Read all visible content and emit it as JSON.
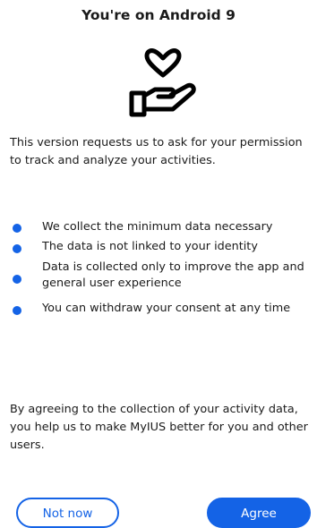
{
  "header": {
    "title": "You're on Android 9"
  },
  "hero": {
    "icon": "hand-holding-heart-icon"
  },
  "intro_text": "This version requests us to ask for your permission to track and analyze your activities.",
  "bullets": [
    {
      "label": "We collect the minimum data necessary"
    },
    {
      "label": "The data is not linked to your identity"
    },
    {
      "label": "Data is collected only to improve the app and general user experience"
    },
    {
      "label": "You can withdraw your consent at any time"
    }
  ],
  "outro_text": "By agreeing to the collection of your activity data, you help us to make MyIUS better for you and other users.",
  "actions": {
    "not_now_label": "Not now",
    "agree_label": "Agree"
  },
  "colors": {
    "accent": "#1463e6",
    "text": "#1a1a1a",
    "background": "#ffffff"
  }
}
